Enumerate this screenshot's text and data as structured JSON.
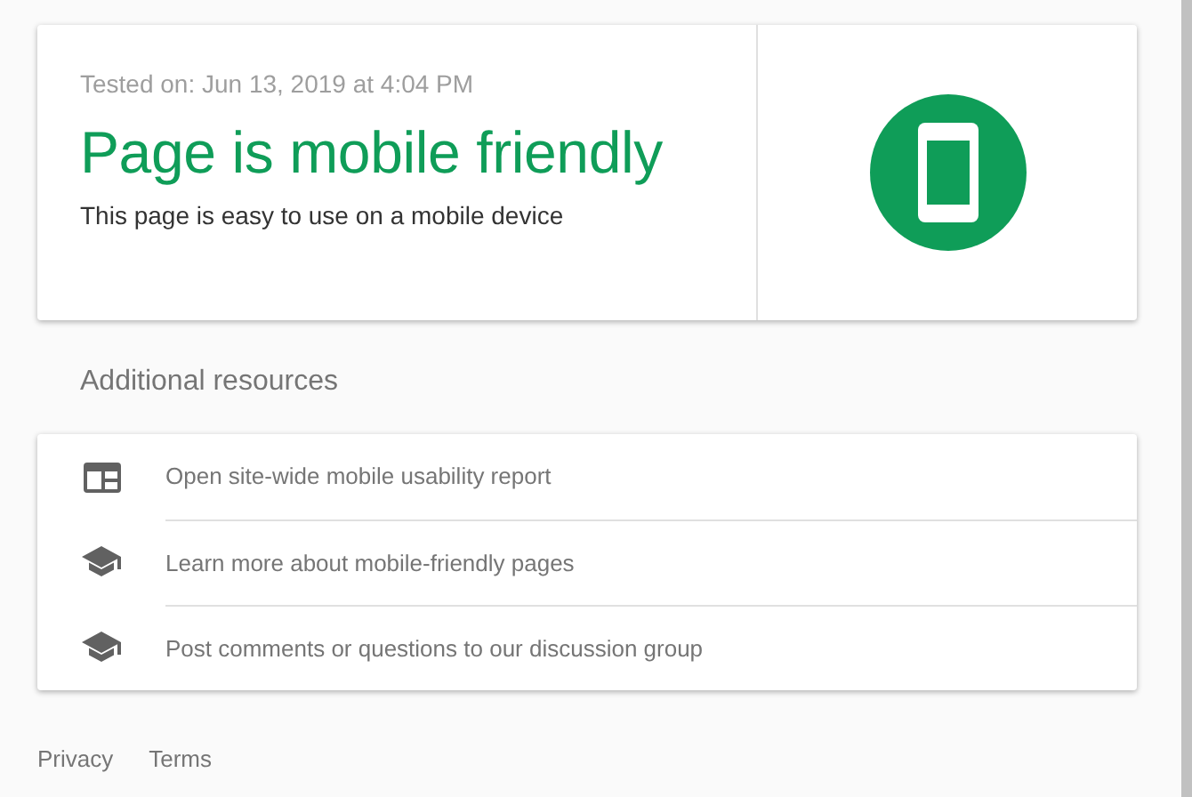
{
  "result": {
    "tested_on": "Tested on: Jun 13, 2019 at 4:04 PM",
    "title": "Page is mobile friendly",
    "description": "This page is easy to use on a mobile device"
  },
  "resources": {
    "heading": "Additional resources",
    "items": [
      {
        "kind": "report",
        "label": "Open site-wide mobile usability report"
      },
      {
        "kind": "school",
        "label": "Learn more about mobile-friendly pages"
      },
      {
        "kind": "school",
        "label": "Post comments or questions to our discussion group"
      }
    ]
  },
  "footer": {
    "links": [
      "Privacy",
      "Terms"
    ]
  }
}
